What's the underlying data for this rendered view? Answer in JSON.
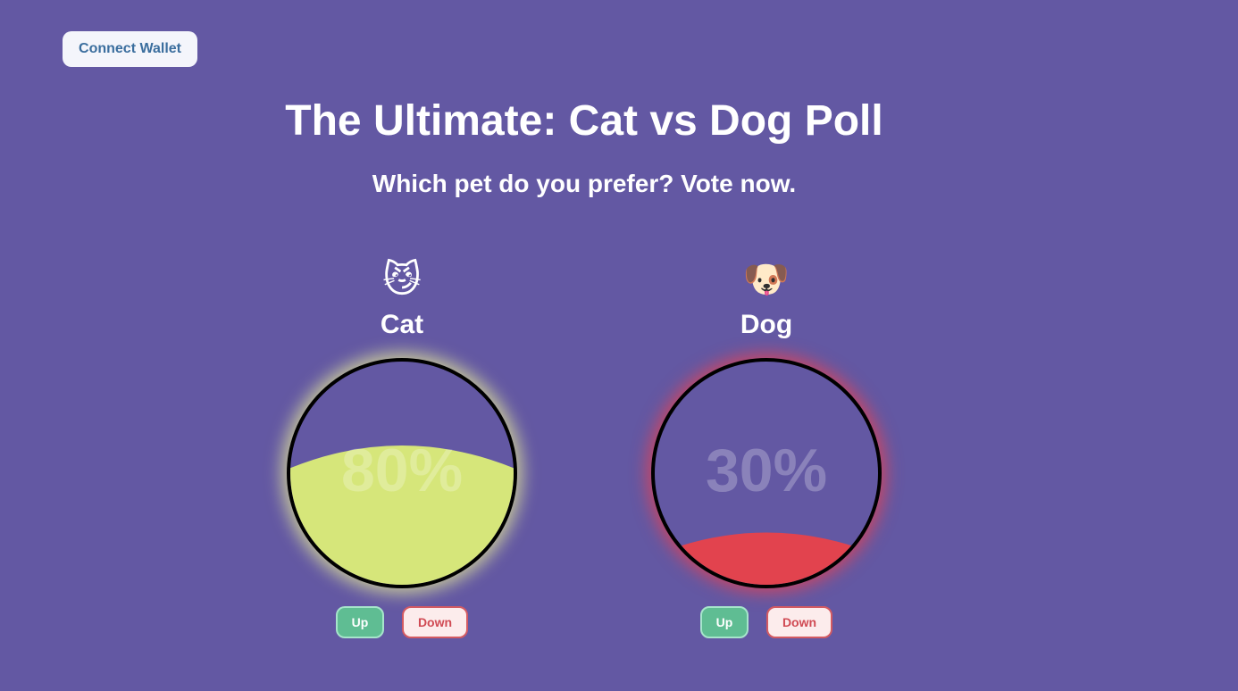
{
  "header": {
    "connect_wallet_label": "Connect Wallet"
  },
  "main": {
    "title": "The Ultimate: Cat vs Dog Poll",
    "subtitle": "Which pet do you prefer? Vote now."
  },
  "candidates": [
    {
      "emoji": "😼",
      "name": "Cat",
      "percent_label": "80%",
      "fill_fraction": 0.8,
      "fill_color": "#d6e67a",
      "glow_color": "#ecf296",
      "up_label": "Up",
      "down_label": "Down"
    },
    {
      "emoji": "🐶",
      "name": "Dog",
      "percent_label": "30%",
      "fill_fraction": 0.3,
      "fill_color": "#e2434e",
      "glow_color": "#e84250",
      "up_label": "Up",
      "down_label": "Down"
    }
  ],
  "colors": {
    "background": "#6358a3",
    "up_button": "#5fbd93",
    "down_button_text": "#d04a53"
  }
}
